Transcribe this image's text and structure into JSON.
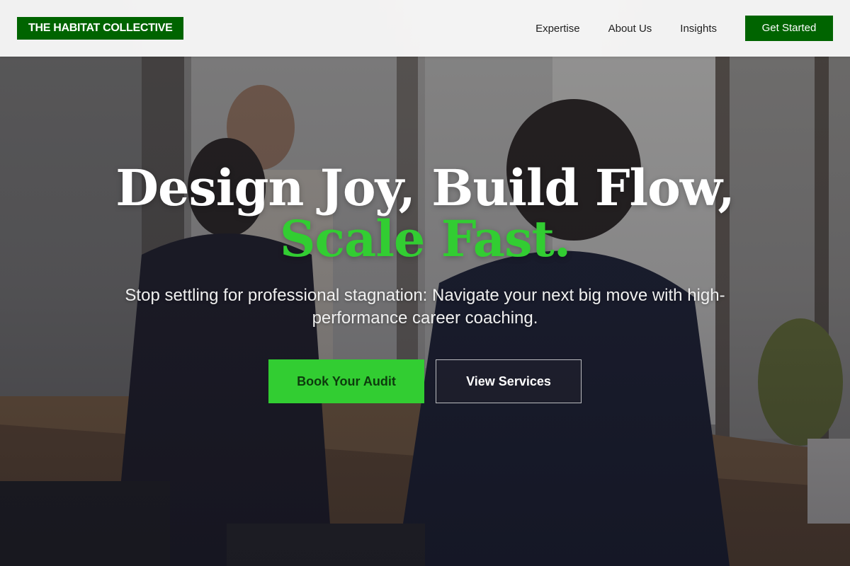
{
  "brand": {
    "logo_text": "THE HABITAT COLLECTIVE",
    "primary_color": "#006400",
    "accent_color": "#32CD32"
  },
  "nav": {
    "items": [
      {
        "label": "Expertise"
      },
      {
        "label": "About Us"
      },
      {
        "label": "Insights"
      }
    ],
    "cta_label": "Get Started"
  },
  "hero": {
    "headline_line1": "Design Joy, Build Flow,",
    "headline_accent": "Scale Fast.",
    "subheadline": "Stop settling for professional stagnation: Navigate your next big move with high-performance career coaching.",
    "primary_button": "Book Your Audit",
    "secondary_button": "View Services",
    "background_image": "office-meeting-photo"
  }
}
